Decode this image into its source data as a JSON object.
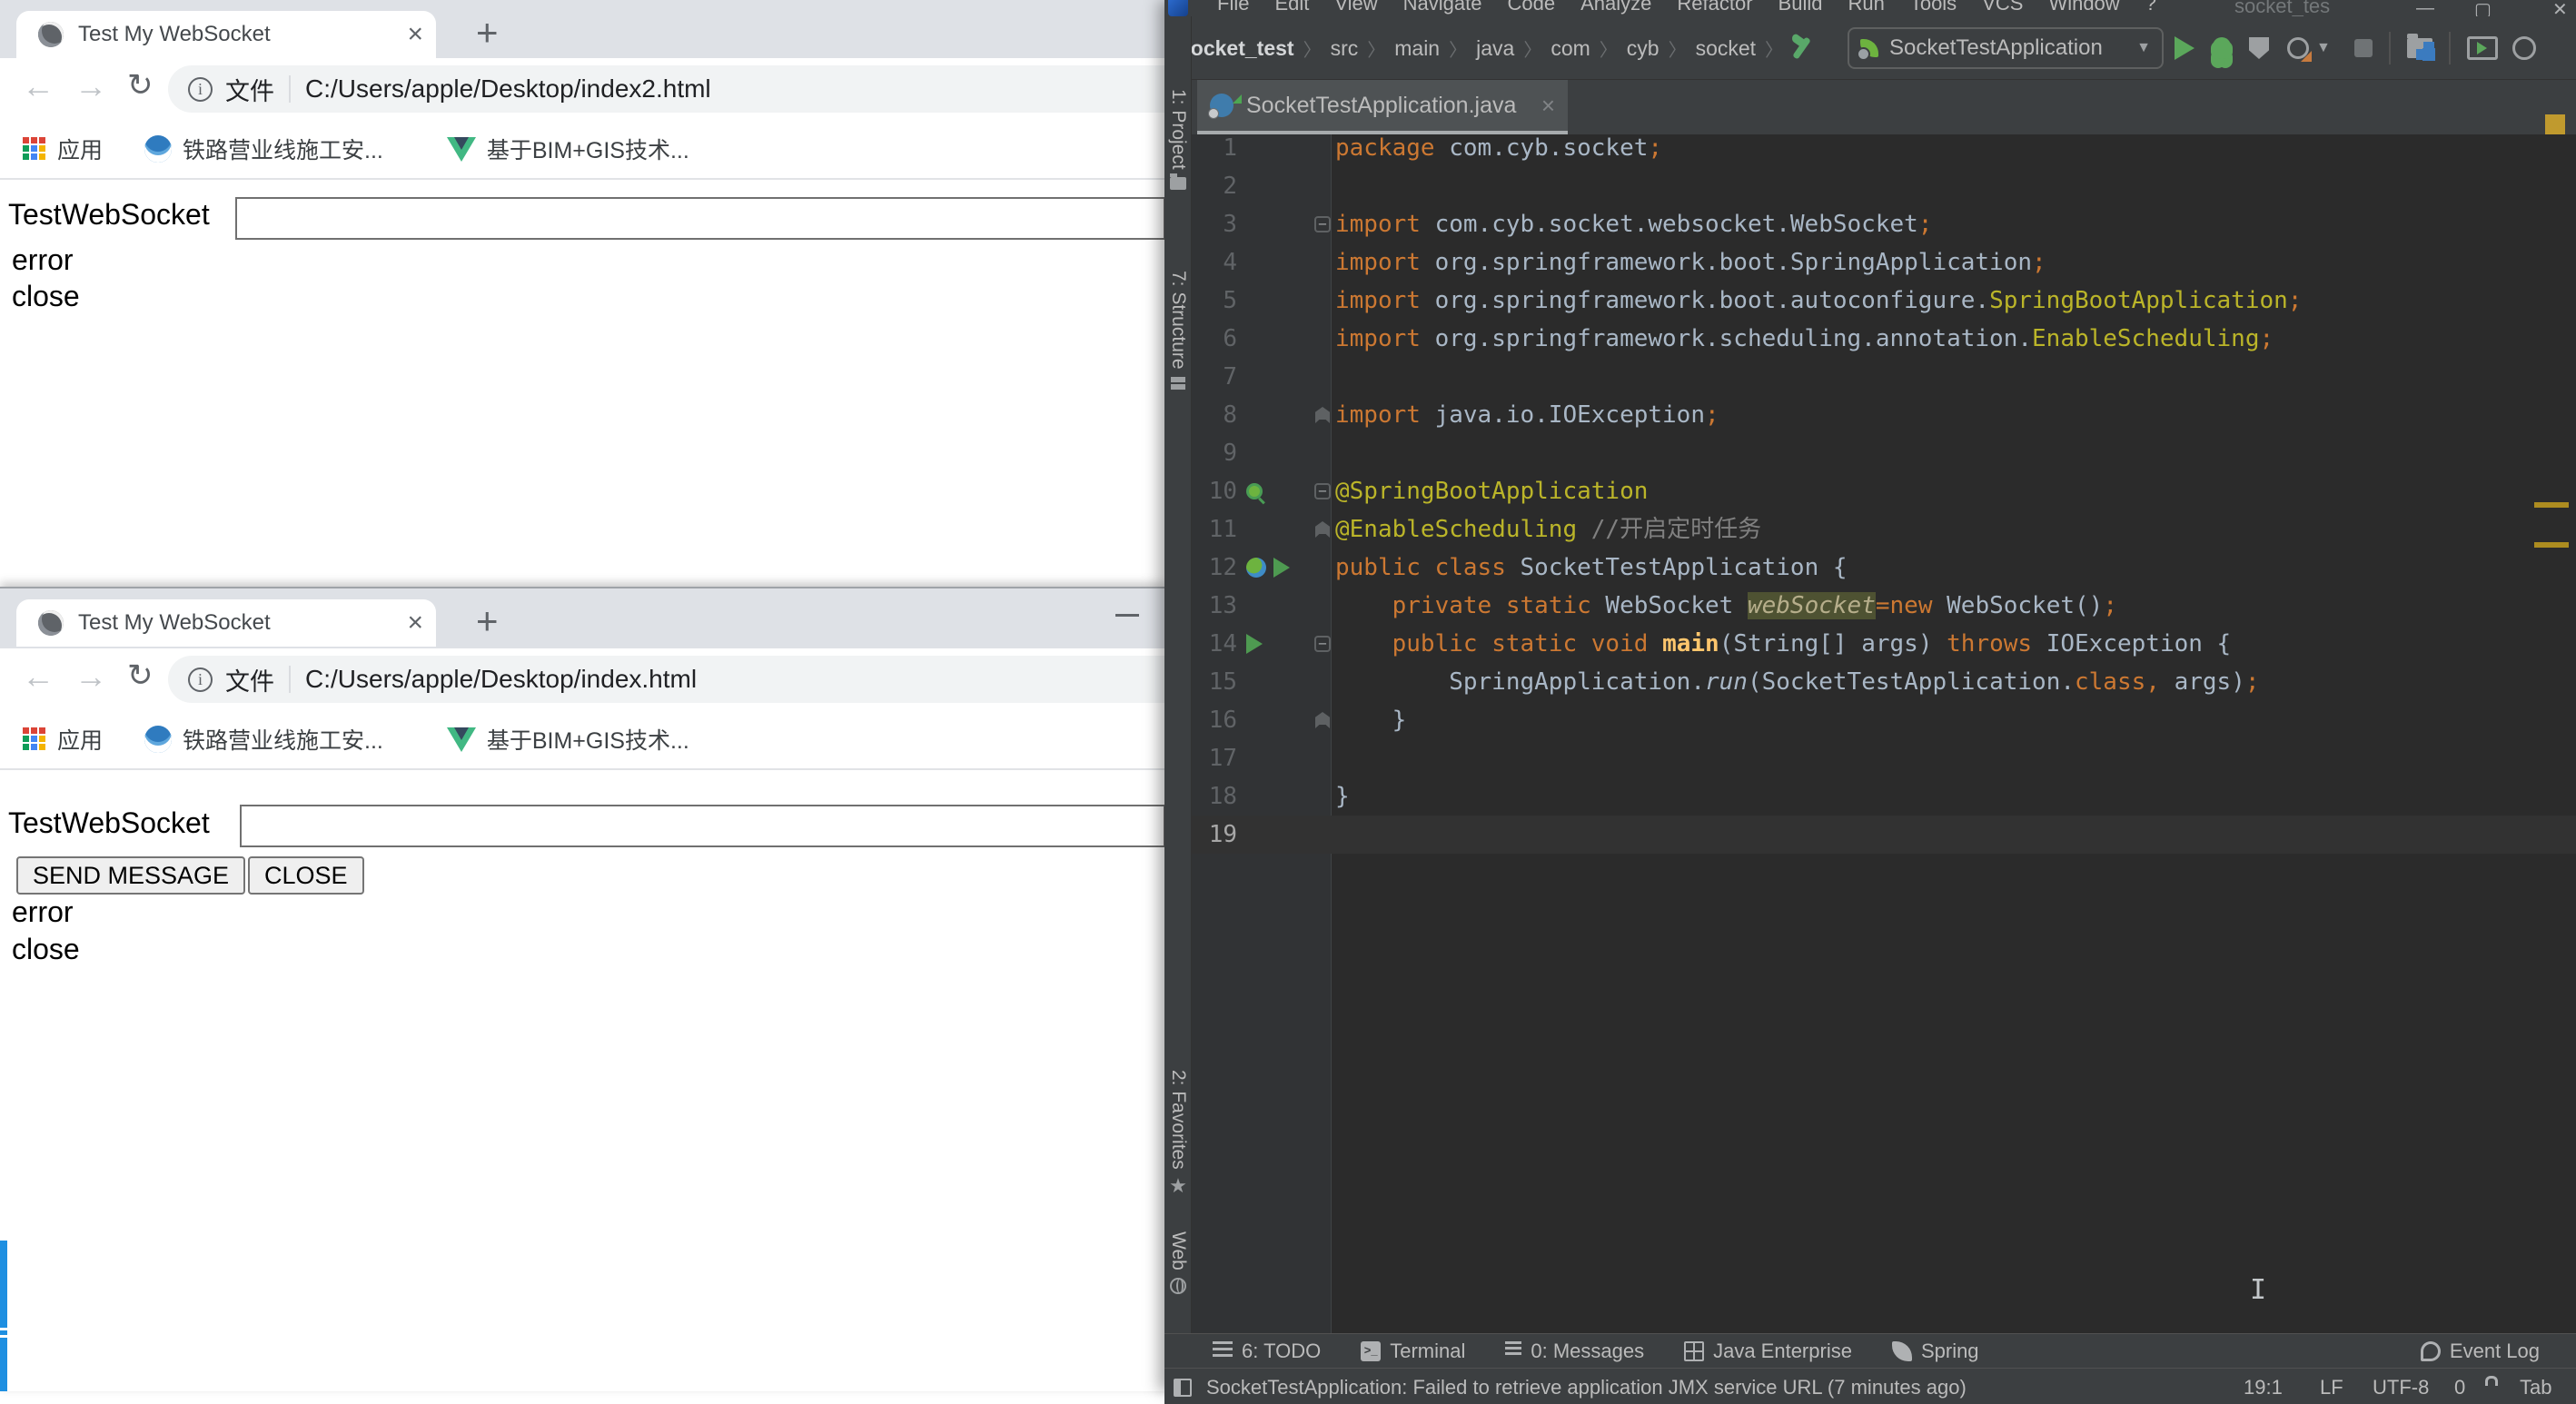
{
  "browser1": {
    "tab_title": "Test My WebSocket",
    "url_prefix": "文件",
    "url": "C:/Users/apple/Desktop/index2.html",
    "bookmarks": [
      "应用",
      "铁路营业线施工安...",
      "基于BIM+GIS技术..."
    ],
    "page": {
      "label": "TestWebSocket",
      "input_value": "",
      "lines": [
        "error",
        "close"
      ]
    }
  },
  "browser2": {
    "tab_title": "Test My WebSocket",
    "url_prefix": "文件",
    "url": "C:/Users/apple/Desktop/index.html",
    "bookmarks": [
      "应用",
      "铁路营业线施工安...",
      "基于BIM+GIS技术..."
    ],
    "page": {
      "label": "TestWebSocket",
      "input_value": "",
      "buttons": [
        "SEND MESSAGE",
        "CLOSE"
      ],
      "lines": [
        "error",
        "close"
      ]
    }
  },
  "ide": {
    "menu": [
      "File",
      "Edit",
      "View",
      "Navigate",
      "Code",
      "Analyze",
      "Refactor",
      "Build",
      "Run",
      "Tools",
      "VCS",
      "Window",
      "?"
    ],
    "window_title": "socket_tes",
    "breadcrumbs": [
      "socket_test",
      "src",
      "main",
      "java",
      "com",
      "cyb",
      "socket"
    ],
    "run_config": "SocketTestApplication",
    "editor_tab": "SocketTestApplication.java",
    "tool_stripe_left": {
      "project": "1: Project",
      "structure": "7: Structure",
      "favorites": "2: Favorites",
      "web": "Web"
    },
    "editor": {
      "lines": [
        {
          "n": 1,
          "t": [
            [
              "k",
              "package"
            ],
            [
              "p",
              " com.cyb.socket"
            ],
            [
              "k",
              ";"
            ]
          ]
        },
        {
          "n": 2,
          "t": []
        },
        {
          "n": 3,
          "fold": "minus",
          "t": [
            [
              "k",
              "import"
            ],
            [
              "p",
              " com.cyb.socket.websocket.WebSocket"
            ],
            [
              "k",
              ";"
            ]
          ]
        },
        {
          "n": 4,
          "t": [
            [
              "k",
              "import"
            ],
            [
              "p",
              " org.springframework.boot.SpringApplication"
            ],
            [
              "k",
              ";"
            ]
          ]
        },
        {
          "n": 5,
          "t": [
            [
              "k",
              "import"
            ],
            [
              "p",
              " org.springframework.boot.autoconfigure."
            ],
            [
              "a",
              "SpringBootApplication"
            ],
            [
              "k",
              ";"
            ]
          ]
        },
        {
          "n": 6,
          "t": [
            [
              "k",
              "import"
            ],
            [
              "p",
              " org.springframework.scheduling.annotation."
            ],
            [
              "a",
              "EnableScheduling"
            ],
            [
              "k",
              ";"
            ]
          ]
        },
        {
          "n": 7,
          "t": []
        },
        {
          "n": 8,
          "fold": "end",
          "t": [
            [
              "k",
              "import"
            ],
            [
              "p",
              " java.io.IOException"
            ],
            [
              "k",
              ";"
            ]
          ]
        },
        {
          "n": 9,
          "t": []
        },
        {
          "n": 10,
          "fold": "minus",
          "icons": [
            "spring-search"
          ],
          "t": [
            [
              "a",
              "@SpringBootApplication"
            ]
          ]
        },
        {
          "n": 11,
          "fold": "end",
          "t": [
            [
              "a",
              "@EnableScheduling"
            ],
            [
              "c",
              " //开启定时任务"
            ]
          ]
        },
        {
          "n": 12,
          "icons": [
            "spring-bean",
            "run"
          ],
          "t": [
            [
              "k",
              "public"
            ],
            [
              "p",
              " "
            ],
            [
              "k",
              "class"
            ],
            [
              "p",
              " SocketTestApplication {"
            ]
          ]
        },
        {
          "n": 13,
          "t": [
            [
              "p",
              "    "
            ],
            [
              "k",
              "private"
            ],
            [
              "p",
              " "
            ],
            [
              "k",
              "static"
            ],
            [
              "p",
              " WebSocket "
            ],
            [
              "f",
              "webSocket"
            ],
            [
              "k",
              "=new"
            ],
            [
              "p",
              " WebSocket()"
            ],
            [
              "k",
              ";"
            ]
          ]
        },
        {
          "n": 14,
          "fold": "minus",
          "icons": [
            "run"
          ],
          "t": [
            [
              "p",
              "    "
            ],
            [
              "k",
              "public"
            ],
            [
              "p",
              " "
            ],
            [
              "k",
              "static"
            ],
            [
              "p",
              " "
            ],
            [
              "k",
              "void"
            ],
            [
              "p",
              " "
            ],
            [
              "m",
              "main"
            ],
            [
              "p",
              "(String[] args) "
            ],
            [
              "k",
              "throws"
            ],
            [
              "p",
              " IOException {"
            ]
          ]
        },
        {
          "n": 15,
          "t": [
            [
              "p",
              "        SpringApplication."
            ],
            [
              "i",
              "run"
            ],
            [
              "p",
              "(SocketTestApplication."
            ],
            [
              "k",
              "class,"
            ],
            [
              "p",
              " args)"
            ],
            [
              "k",
              ";"
            ]
          ]
        },
        {
          "n": 16,
          "fold": "end",
          "t": [
            [
              "p",
              "    }"
            ]
          ]
        },
        {
          "n": 17,
          "t": []
        },
        {
          "n": 18,
          "t": [
            [
              "p",
              "}"
            ]
          ]
        },
        {
          "n": 19,
          "cur": true,
          "t": []
        }
      ]
    },
    "dock": {
      "items": [
        "6: TODO",
        "Terminal",
        "0: Messages",
        "Java Enterprise",
        "Spring"
      ],
      "event_log": "Event Log"
    },
    "statusbar": {
      "message": "SocketTestApplication: Failed to retrieve application JMX service URL (7 minutes ago)",
      "position": "19:1",
      "line_sep": "LF",
      "encoding": "UTF-8",
      "counter": "0",
      "tail": "Tab"
    }
  }
}
